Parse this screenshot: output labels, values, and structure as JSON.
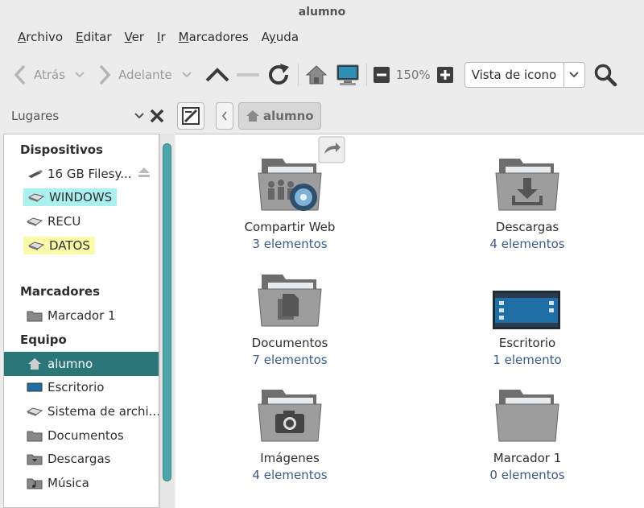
{
  "window": {
    "title": "alumno"
  },
  "menu": [
    "Archivo",
    "Editar",
    "Ver",
    "Ir",
    "Marcadores",
    "Ayuda"
  ],
  "menu_mnemonics": [
    "A",
    "E",
    "V",
    "I",
    "M",
    "y"
  ],
  "toolbar": {
    "back_label": "Atrás",
    "forward_label": "Adelante",
    "zoom_level": "150%",
    "view_mode": "Vista de icono"
  },
  "location": {
    "places_label": "Lugares",
    "breadcrumb": "alumno"
  },
  "sidebar": {
    "devices_header": "Dispositivos",
    "devices": [
      {
        "label": "16 GB Filesy...",
        "icon": "usb-drive-icon"
      },
      {
        "label": "WINDOWS",
        "icon": "drive-icon",
        "highlight": "#aaf0ee"
      },
      {
        "label": "RECU",
        "icon": "drive-icon"
      },
      {
        "label": "DATOS",
        "icon": "drive-icon",
        "highlight": "#fafaa8"
      }
    ],
    "bookmarks_header": "Marcadores",
    "bookmarks": [
      {
        "label": "Marcador 1",
        "icon": "folder-icon"
      }
    ],
    "computer_header": "Equipo",
    "computer": [
      {
        "label": "alumno",
        "icon": "home-icon",
        "selected": true
      },
      {
        "label": "Escritorio",
        "icon": "desktop-icon"
      },
      {
        "label": "Sistema de archi...",
        "icon": "drive-icon"
      },
      {
        "label": "Documentos",
        "icon": "folder-icon"
      },
      {
        "label": "Descargas",
        "icon": "folder-download-icon"
      },
      {
        "label": "Música",
        "icon": "folder-music-icon"
      }
    ]
  },
  "items": [
    {
      "name": "Compartir Web",
      "count": "3 elementos",
      "icon": "folder-share-icon"
    },
    {
      "name": "Descargas",
      "count": "4 elementos",
      "icon": "folder-download-icon"
    },
    {
      "name": "Documentos",
      "count": "7 elementos",
      "icon": "folder-documents-icon"
    },
    {
      "name": "Escritorio",
      "count": "1 elemento",
      "icon": "desktop-icon"
    },
    {
      "name": "Imágenes",
      "count": "4 elementos",
      "icon": "folder-pictures-icon"
    },
    {
      "name": "Marcador 1",
      "count": "0 elementos",
      "icon": "folder-icon"
    }
  ],
  "colors": {
    "selection": "#2b7679",
    "count_text": "#3c5a8c",
    "scroll_thumb": "#4fa6aa"
  }
}
